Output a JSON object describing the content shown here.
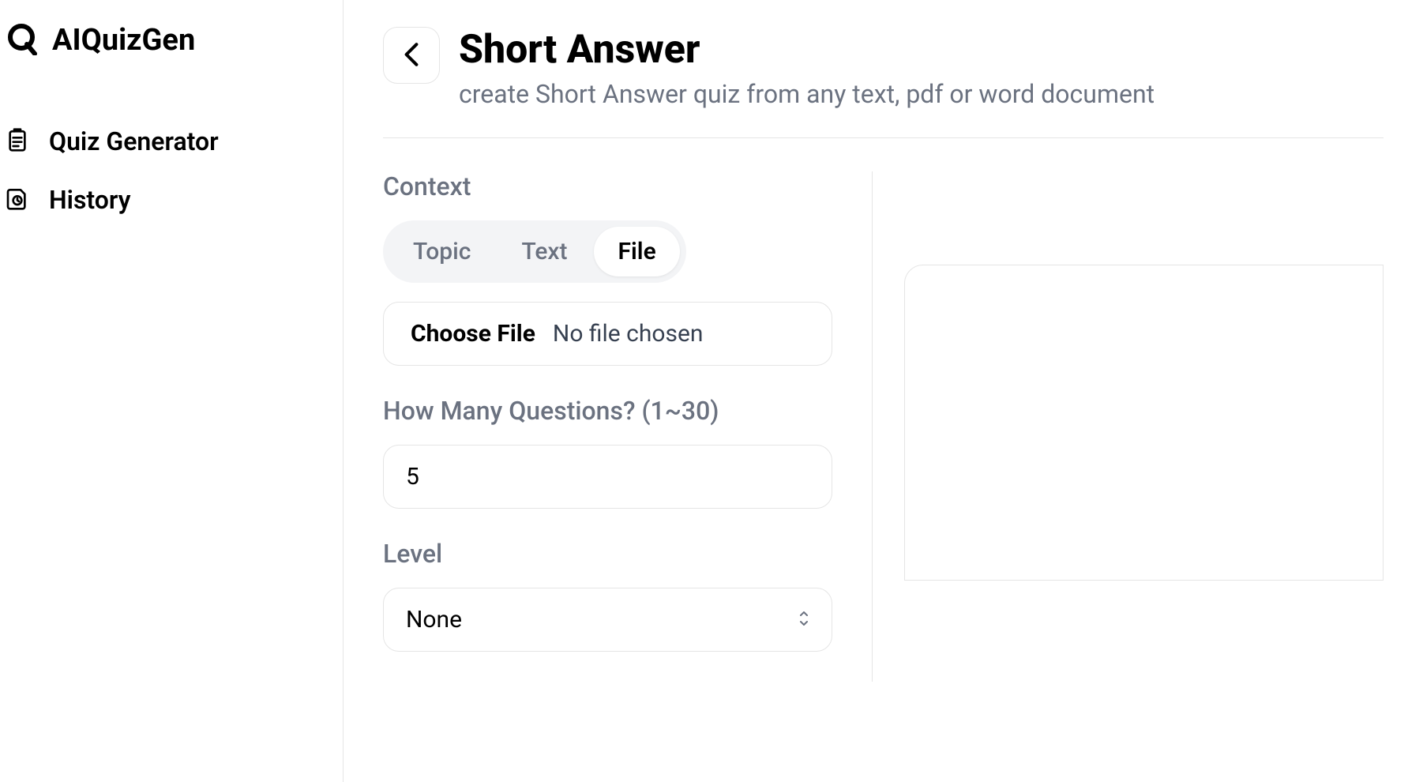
{
  "app": {
    "name": "AIQuizGen"
  },
  "sidebar": {
    "items": [
      {
        "label": "Quiz Generator"
      },
      {
        "label": "History"
      }
    ]
  },
  "header": {
    "title": "Short Answer",
    "subtitle": "create Short Answer quiz from any text, pdf or word document"
  },
  "form": {
    "context_label": "Context",
    "tabs": [
      {
        "label": "Topic"
      },
      {
        "label": "Text"
      },
      {
        "label": "File"
      }
    ],
    "file_button": "Choose File",
    "file_status": "No file chosen",
    "questions_label": "How Many Questions? (1~30)",
    "questions_value": "5",
    "level_label": "Level",
    "level_value": "None"
  }
}
